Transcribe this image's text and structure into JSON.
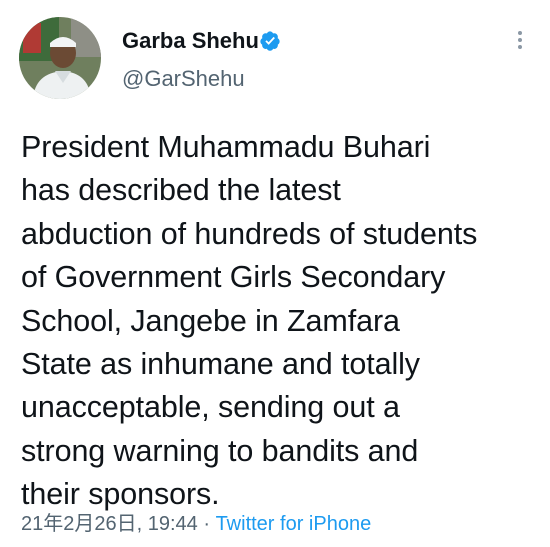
{
  "author": {
    "display_name": "Garba Shehu",
    "handle": "@GarShehu",
    "verified_icon": "verified-badge-icon"
  },
  "menu": {
    "icon": "more-vertical-icon"
  },
  "tweet": {
    "lines": [
      "President Muhammadu Buhari",
      "has described the latest",
      "abduction of hundreds of students",
      "of Government Girls Secondary",
      "School, Jangebe in Zamfara",
      "State as inhumane and totally",
      "unacceptable, sending out a",
      "strong warning to bandits and",
      "their sponsors."
    ],
    "timestamp": "21年2月26日, 19:44",
    "separator": " · ",
    "source": "Twitter for iPhone"
  },
  "colors": {
    "link": "#1d9bf0",
    "secondary": "#536471",
    "verified": "#1d9bf0"
  }
}
